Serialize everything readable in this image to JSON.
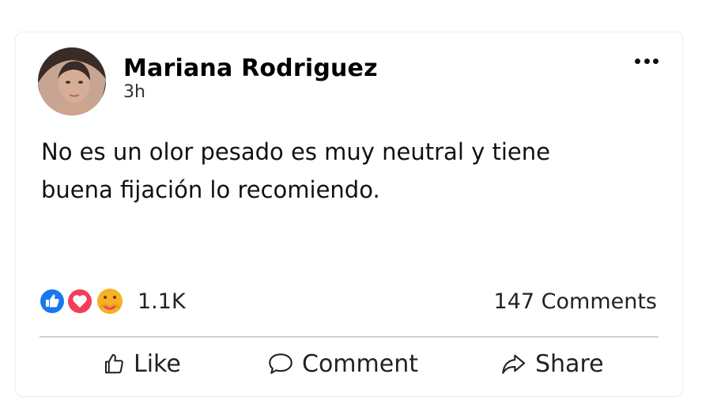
{
  "post": {
    "author": "Mariana Rodriguez",
    "time": "3h",
    "text": "No es un olor pesado es muy neutral y tiene buena fijación lo recomiendo.",
    "reactions": {
      "types": [
        "like-icon",
        "love-icon",
        "care-icon"
      ],
      "count": "1.1K"
    },
    "comments_count": "147 Comments",
    "actions": {
      "like": "Like",
      "comment": "Comment",
      "share": "Share"
    }
  },
  "colors": {
    "like_blue": "#1877f2",
    "love_red": "#f33e58",
    "care_yellow": "#f7b125",
    "divider": "#c9d2dc"
  }
}
